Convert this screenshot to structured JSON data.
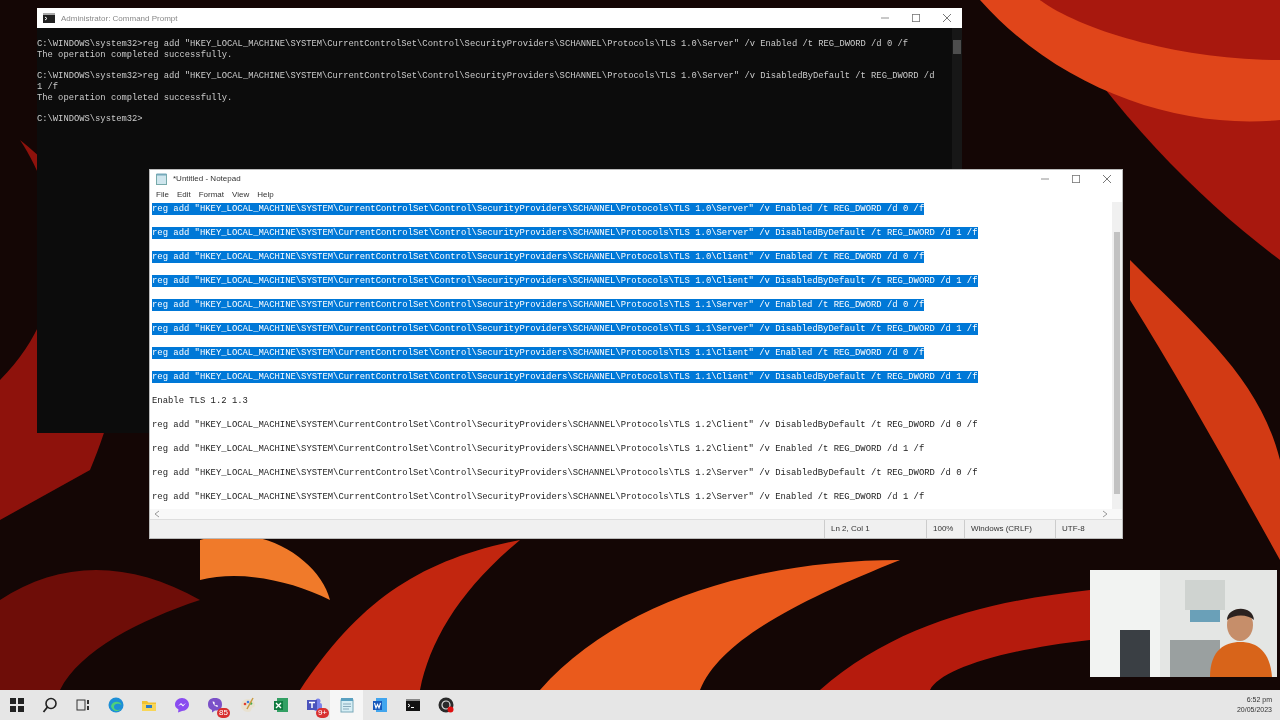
{
  "command_prompt": {
    "title": "Administrator: Command Prompt",
    "blocks": [
      [
        "C:\\WINDOWS\\system32>reg add \"HKEY_LOCAL_MACHINE\\SYSTEM\\CurrentControlSet\\Control\\SecurityProviders\\SCHANNEL\\Protocols\\TLS 1.0\\Server\" /v Enabled /t REG_DWORD /d 0 /f",
        "The operation completed successfully."
      ],
      [
        "C:\\WINDOWS\\system32>reg add \"HKEY_LOCAL_MACHINE\\SYSTEM\\CurrentControlSet\\Control\\SecurityProviders\\SCHANNEL\\Protocols\\TLS 1.0\\Server\" /v DisabledByDefault /t REG_DWORD /d",
        "1 /f",
        "The operation completed successfully."
      ],
      [
        "C:\\WINDOWS\\system32>"
      ]
    ]
  },
  "notepad": {
    "title": "*Untitled - Notepad",
    "menu": [
      "File",
      "Edit",
      "Format",
      "View",
      "Help"
    ],
    "lines": [
      {
        "text": "reg add \"HKEY_LOCAL_MACHINE\\SYSTEM\\CurrentControlSet\\Control\\SecurityProviders\\SCHANNEL\\Protocols\\TLS 1.0\\Server\" /v Enabled /t REG_DWORD /d 0 /f",
        "selected": true
      },
      {
        "text": "reg add \"HKEY_LOCAL_MACHINE\\SYSTEM\\CurrentControlSet\\Control\\SecurityProviders\\SCHANNEL\\Protocols\\TLS 1.0\\Server\" /v DisabledByDefault /t REG_DWORD /d 1 /f",
        "selected": true
      },
      {
        "text": "reg add \"HKEY_LOCAL_MACHINE\\SYSTEM\\CurrentControlSet\\Control\\SecurityProviders\\SCHANNEL\\Protocols\\TLS 1.0\\Client\" /v Enabled /t REG_DWORD /d 0 /f",
        "selected": true
      },
      {
        "text": "reg add \"HKEY_LOCAL_MACHINE\\SYSTEM\\CurrentControlSet\\Control\\SecurityProviders\\SCHANNEL\\Protocols\\TLS 1.0\\Client\" /v DisabledByDefault /t REG_DWORD /d 1 /f",
        "selected": true
      },
      {
        "text": "reg add \"HKEY_LOCAL_MACHINE\\SYSTEM\\CurrentControlSet\\Control\\SecurityProviders\\SCHANNEL\\Protocols\\TLS 1.1\\Server\" /v Enabled /t REG_DWORD /d 0 /f",
        "selected": true
      },
      {
        "text": "reg add \"HKEY_LOCAL_MACHINE\\SYSTEM\\CurrentControlSet\\Control\\SecurityProviders\\SCHANNEL\\Protocols\\TLS 1.1\\Server\" /v DisabledByDefault /t REG_DWORD /d 1 /f",
        "selected": true
      },
      {
        "text": "reg add \"HKEY_LOCAL_MACHINE\\SYSTEM\\CurrentControlSet\\Control\\SecurityProviders\\SCHANNEL\\Protocols\\TLS 1.1\\Client\" /v Enabled /t REG_DWORD /d 0 /f",
        "selected": true
      },
      {
        "text": "reg add \"HKEY_LOCAL_MACHINE\\SYSTEM\\CurrentControlSet\\Control\\SecurityProviders\\SCHANNEL\\Protocols\\TLS 1.1\\Client\" /v DisabledByDefault /t REG_DWORD /d 1 /f",
        "selected": true
      },
      {
        "text": "Enable TLS 1.2 1.3",
        "selected": false
      },
      {
        "text": "reg add \"HKEY_LOCAL_MACHINE\\SYSTEM\\CurrentControlSet\\Control\\SecurityProviders\\SCHANNEL\\Protocols\\TLS 1.2\\Client\" /v DisabledByDefault /t REG_DWORD /d 0 /f",
        "selected": false
      },
      {
        "text": "reg add \"HKEY_LOCAL_MACHINE\\SYSTEM\\CurrentControlSet\\Control\\SecurityProviders\\SCHANNEL\\Protocols\\TLS 1.2\\Client\" /v Enabled /t REG_DWORD /d 1 /f",
        "selected": false
      },
      {
        "text": "reg add \"HKEY_LOCAL_MACHINE\\SYSTEM\\CurrentControlSet\\Control\\SecurityProviders\\SCHANNEL\\Protocols\\TLS 1.2\\Server\" /v DisabledByDefault /t REG_DWORD /d 0 /f",
        "selected": false
      },
      {
        "text": "reg add \"HKEY_LOCAL_MACHINE\\SYSTEM\\CurrentControlSet\\Control\\SecurityProviders\\SCHANNEL\\Protocols\\TLS 1.2\\Server\" /v Enabled /t REG_DWORD /d 1 /f",
        "selected": false
      }
    ],
    "status_bar": {
      "position": "Ln 2, Col 1",
      "zoom": "100%",
      "line_ending": "Windows (CRLF)",
      "encoding": "UTF-8"
    }
  },
  "taskbar": {
    "items": [
      {
        "kind": "start",
        "selected": false
      },
      {
        "kind": "search",
        "selected": false
      },
      {
        "kind": "taskview",
        "selected": false
      },
      {
        "kind": "edge",
        "selected": false
      },
      {
        "kind": "explorer",
        "selected": false
      },
      {
        "kind": "messenger",
        "selected": false
      },
      {
        "kind": "viber",
        "selected": false,
        "badge": "85"
      },
      {
        "kind": "paint",
        "selected": false
      },
      {
        "kind": "excel",
        "selected": false
      },
      {
        "kind": "teams",
        "selected": false,
        "badge": "9+"
      },
      {
        "kind": "notepad",
        "selected": true
      },
      {
        "kind": "word",
        "selected": false
      },
      {
        "kind": "terminal",
        "selected": false
      },
      {
        "kind": "obs",
        "selected": false
      }
    ],
    "clock": {
      "time": "6:52 pm",
      "date": "20/05/2023"
    }
  }
}
